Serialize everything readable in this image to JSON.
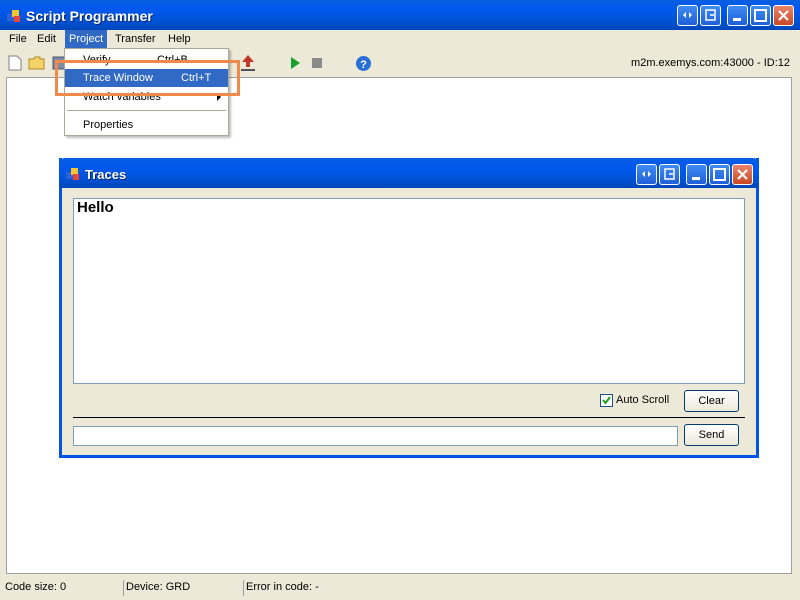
{
  "window": {
    "title": "Script Programmer"
  },
  "menubar": {
    "items": [
      {
        "label": "File"
      },
      {
        "label": "Edit"
      },
      {
        "label": "Project"
      },
      {
        "label": "Transfer"
      },
      {
        "label": "Help"
      }
    ]
  },
  "project_menu": {
    "items": [
      {
        "label": "Verify",
        "shortcut": "Ctrl+B"
      },
      {
        "label": "Trace Window",
        "shortcut": "Ctrl+T"
      },
      {
        "label": "Watch variables",
        "shortcut": ""
      },
      {
        "label": "Properties",
        "shortcut": ""
      }
    ]
  },
  "toolbar": {
    "server_info": "m2m.exemys.com:43000 - ID:12"
  },
  "traces": {
    "title": "Traces",
    "output_text": "Hello",
    "auto_scroll_label": "Auto Scroll",
    "auto_scroll_checked": true,
    "clear_label": "Clear",
    "send_label": "Send",
    "send_value": ""
  },
  "statusbar": {
    "code_size": "Code size: 0",
    "device": "Device: GRD",
    "error": "Error in code: -"
  },
  "colors": {
    "titlebar": "#0054e3",
    "highlight": "#316ac5",
    "annotation": "#f08a4b"
  }
}
